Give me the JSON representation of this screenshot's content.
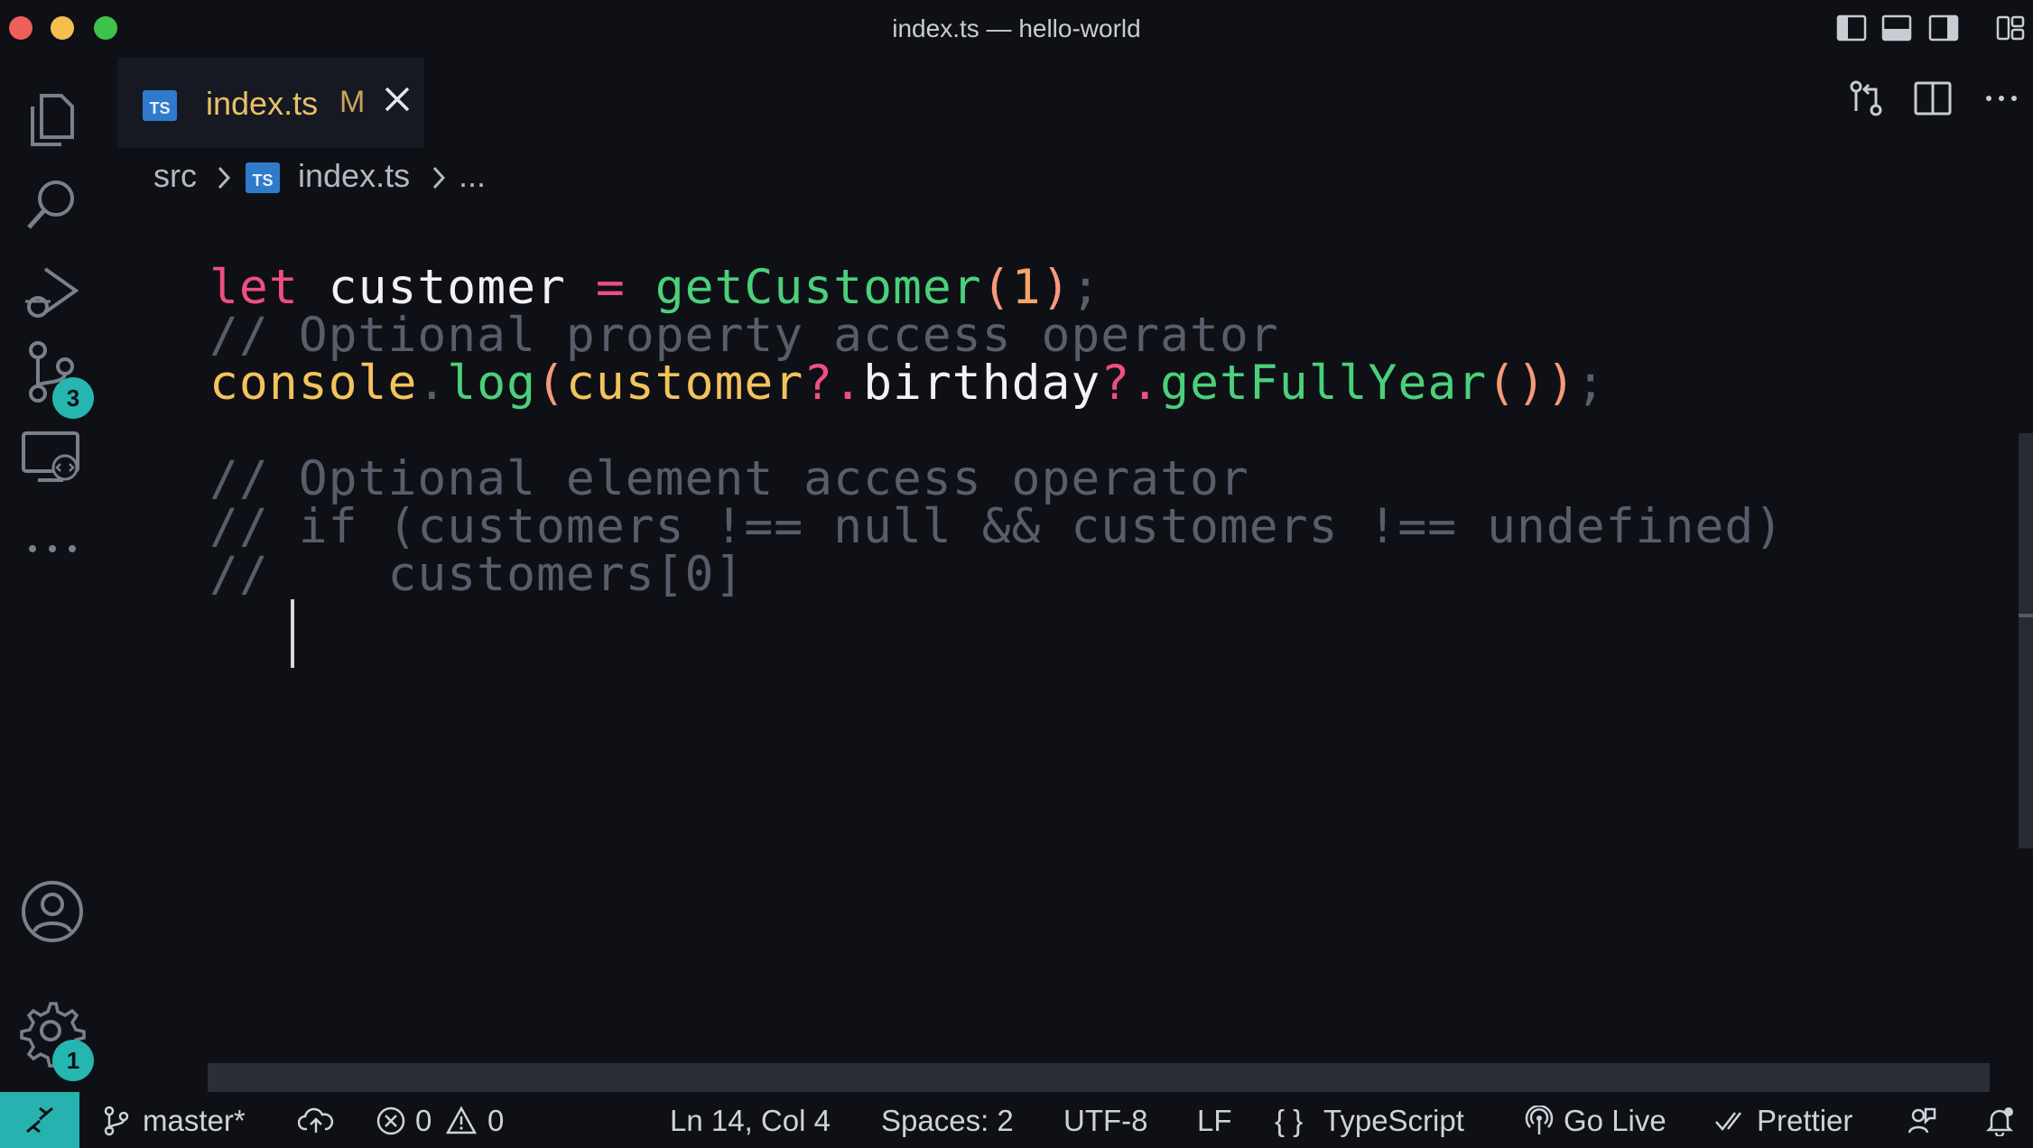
{
  "window": {
    "title": "index.ts — hello-world"
  },
  "activity_bar": {
    "source_control_badge": "3",
    "settings_badge": "1"
  },
  "tab": {
    "label": "index.ts",
    "modified_marker": "M",
    "icon_text": "TS"
  },
  "breadcrumb": {
    "folder": "src",
    "file": "index.ts",
    "more": "..."
  },
  "code_lines": [
    "let customer = getCustomer(1);",
    "// Optional property access operator",
    "console.log(customer?.birthday?.getFullYear());",
    "",
    "// Optional element access operator",
    "// if (customers !== null && customers !== undefined)",
    "//    customers[0]"
  ],
  "status_bar": {
    "branch": "master*",
    "errors": "0",
    "warnings": "0",
    "cursor_position": "Ln 14, Col 4",
    "indentation": "Spaces: 2",
    "encoding": "UTF-8",
    "line_ending": "LF",
    "language_braces": "{ }",
    "language": "TypeScript",
    "go_live": "Go Live",
    "prettier": "Prettier"
  },
  "colors": {
    "background": "#0e1016",
    "keyword": "#ef4f7f",
    "function": "#4bd07a",
    "number": "#f6a56a",
    "object": "#f3c35c",
    "comment": "#585d6a",
    "accent": "#26b3b0",
    "tab_label": "#e8c06a"
  }
}
